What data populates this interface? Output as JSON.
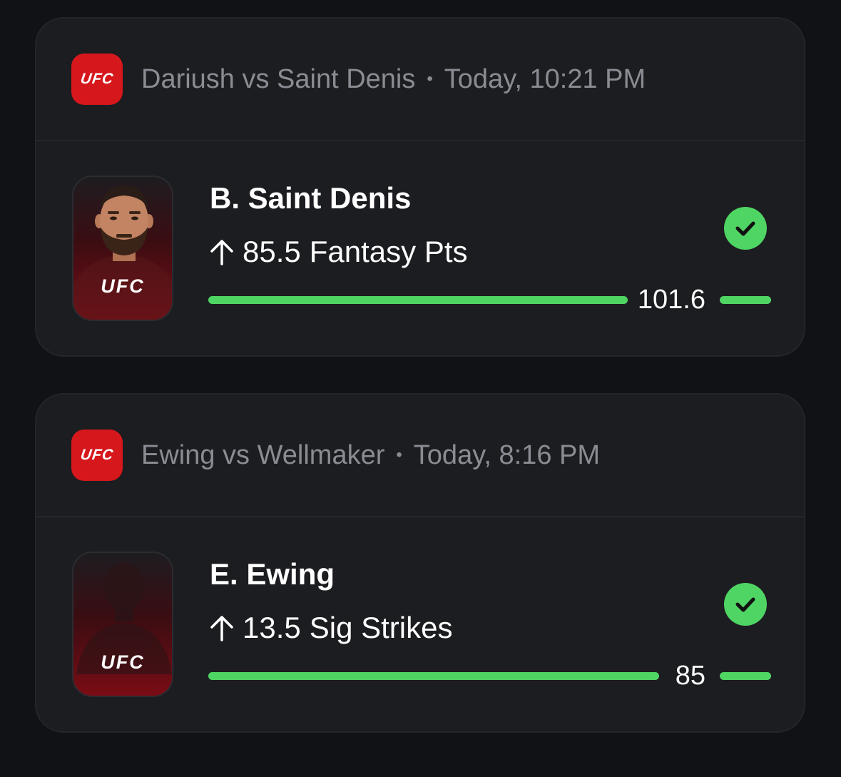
{
  "colors": {
    "background": "#111216",
    "card": "#1c1d21",
    "accent_green": "#4fd564",
    "ufc_red": "#d6171b",
    "muted_text": "#8b8c93"
  },
  "picks": [
    {
      "league_logo": "UFC",
      "matchup": "Dariush vs Saint Denis",
      "separator": "•",
      "time": "Today, 10:21 PM",
      "player_name": "B. Saint Denis",
      "direction_icon": "arrow-up-icon",
      "line": "85.5",
      "stat": "Fantasy Pts",
      "result": "101.6",
      "status_icon": "checkmark-icon",
      "card_logo": "UFC"
    },
    {
      "league_logo": "UFC",
      "matchup": "Ewing vs Wellmaker",
      "separator": "•",
      "time": "Today, 8:16 PM",
      "player_name": "E. Ewing",
      "direction_icon": "arrow-up-icon",
      "line": "13.5",
      "stat": "Sig Strikes",
      "result": "85",
      "status_icon": "checkmark-icon",
      "card_logo": "UFC"
    }
  ]
}
